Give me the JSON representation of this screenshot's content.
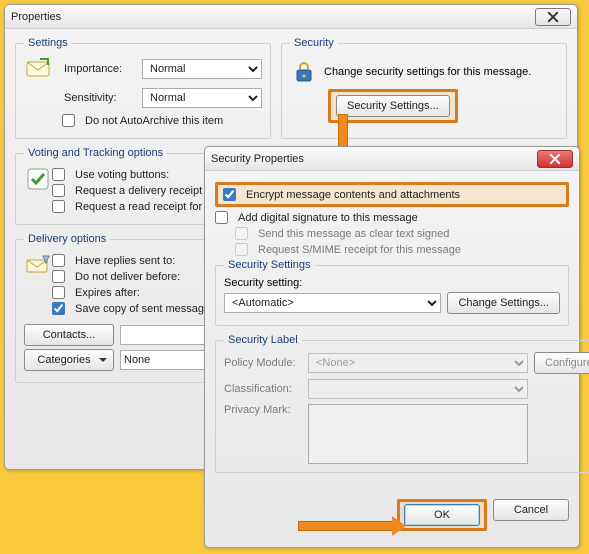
{
  "properties": {
    "title": "Properties",
    "settings": {
      "legend": "Settings",
      "importance_label": "Importance:",
      "importance_value": "Normal",
      "sensitivity_label": "Sensitivity:",
      "sensitivity_value": "Normal",
      "autoarchive_label": "Do not AutoArchive this item",
      "autoarchive_checked": false
    },
    "security": {
      "legend": "Security",
      "desc": "Change security settings for this message.",
      "button": "Security Settings..."
    },
    "voting": {
      "legend": "Voting and Tracking options",
      "use_voting_label": "Use voting buttons:",
      "delivery_receipt_label": "Request a delivery receipt for this message",
      "read_receipt_label": "Request a read receipt for this message"
    },
    "delivery": {
      "legend": "Delivery options",
      "replies_label": "Have replies sent to:",
      "no_deliver_label": "Do not deliver before:",
      "expires_label": "Expires after:",
      "save_copy_label": "Save copy of sent message",
      "save_copy_checked": true,
      "contacts_btn": "Contacts...",
      "categories_btn": "Categories",
      "categories_value": "None"
    }
  },
  "secprops": {
    "title": "Security Properties",
    "encrypt_label": "Encrypt message contents and attachments",
    "encrypt_checked": true,
    "sign_label": "Add digital signature to this message",
    "cleartext_label": "Send this message as clear text signed",
    "smime_label": "Request S/MIME receipt for this message",
    "settings": {
      "legend": "Security Settings",
      "setting_label": "Security setting:",
      "setting_value": "<Automatic>",
      "change_btn": "Change Settings..."
    },
    "label": {
      "legend": "Security Label",
      "policy_label": "Policy Module:",
      "policy_value": "<None>",
      "configure_btn": "Configure...",
      "classification_label": "Classification:",
      "privacy_label": "Privacy Mark:"
    },
    "ok": "OK",
    "cancel": "Cancel"
  }
}
